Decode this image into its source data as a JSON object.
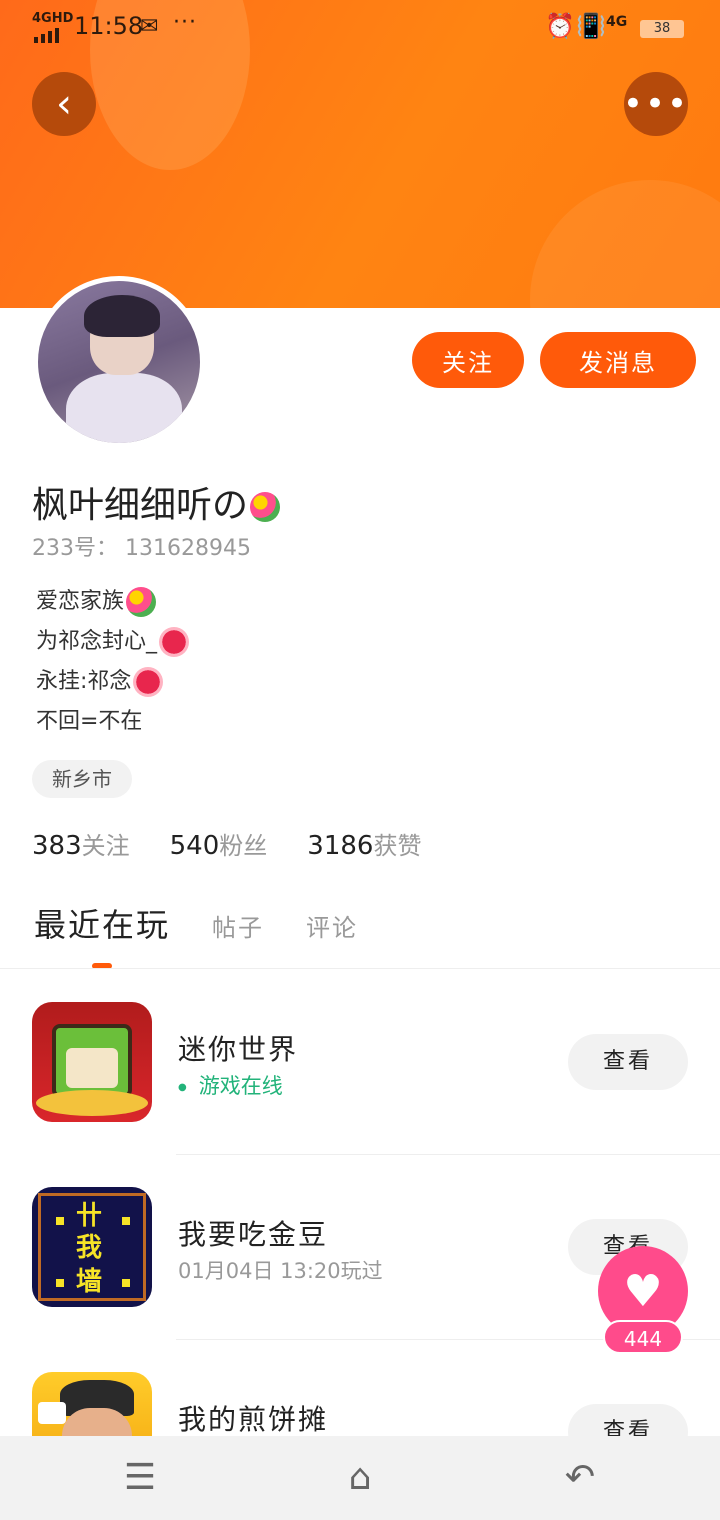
{
  "status_bar": {
    "network": "4GHD",
    "time": "11:58",
    "extra": "···",
    "network_right": "4G",
    "battery": "38"
  },
  "header": {
    "back_icon": "chevron-left-icon",
    "more_icon": "more-horizontal-icon",
    "accent_color": "#ff6a1a"
  },
  "profile": {
    "follow_label": "关注",
    "message_label": "发消息",
    "username": "枫叶细细听の",
    "uid_label": "233号：",
    "uid": "131628945",
    "bio": [
      "爱恋家族",
      "为祁念封心_",
      "永挂:祁念",
      "不回=不在"
    ],
    "location": "新乡市",
    "stats": [
      {
        "num": "383",
        "label": "关注"
      },
      {
        "num": "540",
        "label": "粉丝"
      },
      {
        "num": "3186",
        "label": "获赞"
      }
    ]
  },
  "tabs": [
    {
      "label": "最近在玩",
      "active": true
    },
    {
      "label": "帖子",
      "active": false
    },
    {
      "label": "评论",
      "active": false
    }
  ],
  "games": [
    {
      "name": "迷你世界",
      "sub": "游戏在线",
      "online": true,
      "view_label": "查看",
      "icon": "mini-world-icon"
    },
    {
      "name": "我要吃金豆",
      "sub": "01月04日 13:20玩过",
      "online": false,
      "view_label": "查看",
      "icon": "eat-gold-beans-icon"
    },
    {
      "name": "我的煎饼摊",
      "sub": "",
      "online": false,
      "view_label": "查看",
      "icon": "pancake-stall-icon"
    }
  ],
  "like": {
    "count": "444",
    "icon": "heart-icon",
    "color": "#ff4b8b"
  },
  "navbar": {
    "menu_icon": "menu-icon",
    "home_icon": "home-icon",
    "back_icon": "back-icon"
  }
}
